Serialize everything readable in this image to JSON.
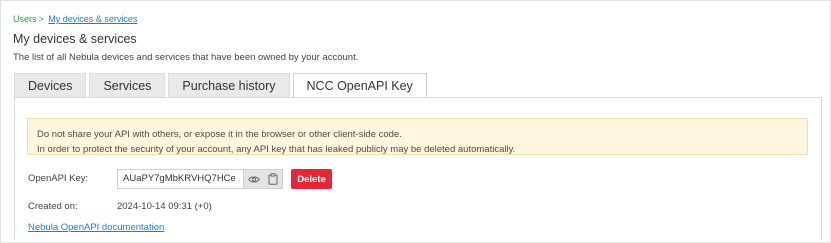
{
  "breadcrumb": {
    "root": "Users",
    "separator": ">",
    "current": "My devices & services"
  },
  "page": {
    "title": "My devices & services",
    "description": "The list of all Nebula devices and services that have been owned by your account."
  },
  "tabs": [
    {
      "label": "Devices",
      "active": false
    },
    {
      "label": "Services",
      "active": false
    },
    {
      "label": "Purchase history",
      "active": false
    },
    {
      "label": "NCC OpenAPI Key",
      "active": true
    }
  ],
  "alert": {
    "line1": "Do not share your API with others, or expose it in the browser or other client-side code.",
    "line2": "In order to protect the security of your account, any API key that has leaked publicly may be deleted automatically."
  },
  "api_key": {
    "label": "OpenAPI Key:",
    "value": "AUaPY7gMbKRVHQ7HCe",
    "show_icon": "eye-icon",
    "copy_icon": "copy-icon",
    "delete_label": "Delete"
  },
  "created": {
    "label": "Created on:",
    "value": "2024-10-14 09:31 (+0)"
  },
  "doc_link": "Nebula OpenAPI documentation",
  "colors": {
    "link": "#1a7fd6",
    "breadcrumb_root": "#2a9a4a",
    "delete": "#e52638",
    "alert_bg": "#fff6e0"
  }
}
